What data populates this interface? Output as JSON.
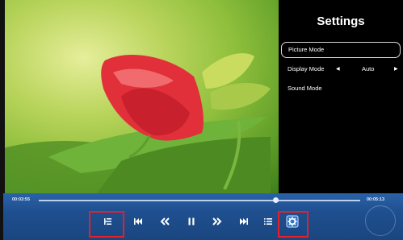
{
  "settings": {
    "title": "Settings",
    "items": [
      {
        "label": "Picture Mode",
        "selected": true
      },
      {
        "label": "Display Mode",
        "value": "Auto",
        "left_arrow": "◀",
        "right_arrow": "▶"
      },
      {
        "label": "Sound Mode"
      }
    ]
  },
  "player": {
    "elapsed": "00:03:55",
    "total": "00:05:13",
    "progress": 0.73,
    "buttons": [
      "playlist-icon",
      "skip-previous-icon",
      "rewind-icon",
      "pause-icon",
      "fast-forward-icon",
      "skip-next-icon",
      "list-icon",
      "settings-gear-icon"
    ]
  },
  "colors": {
    "bar": "#1f4f8f",
    "highlight": "#e5202a"
  }
}
